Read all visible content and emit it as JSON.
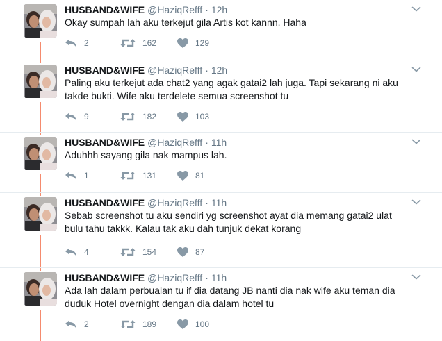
{
  "colors": {
    "thread_line": "#f58b6e",
    "name": "#14171a",
    "secondary": "#657786",
    "divider": "#e6ecf0"
  },
  "icons": {
    "avatar": "couple-profile-photo",
    "reply": "reply-icon",
    "retweet": "retweet-icon",
    "like": "heart-icon",
    "more": "chevron-down-icon"
  },
  "tweets": [
    {
      "name": "HUSBAND&WIFE",
      "handle": "@HaziqRefff",
      "separator": "·",
      "time": "12h",
      "text": "Okay sumpah lah aku terkejut gila Artis kot kannn. Haha",
      "replies": "2",
      "retweets": "162",
      "likes": "129"
    },
    {
      "name": "HUSBAND&WIFE",
      "handle": "@HaziqRefff",
      "separator": "·",
      "time": "12h",
      "text": "Paling aku terkejut ada chat2 yang agak gatai2 lah juga. Tapi sekarang ni aku\ntakde bukti. Wife aku terdelete semua screenshot tu",
      "replies": "9",
      "retweets": "182",
      "likes": "103"
    },
    {
      "name": "HUSBAND&WIFE",
      "handle": "@HaziqRefff",
      "separator": "·",
      "time": "11h",
      "text": "Aduhhh sayang gila nak mampus lah.",
      "replies": "1",
      "retweets": "131",
      "likes": "81"
    },
    {
      "name": "HUSBAND&WIFE",
      "handle": "@HaziqRefff",
      "separator": "·",
      "time": "11h",
      "text": "Sebab screenshot tu aku sendiri yg screenshot ayat dia memang gatai2 ulat\nbulu tahu takkk. Kalau tak aku dah tunjuk dekat korang",
      "replies": "4",
      "retweets": "154",
      "likes": "87"
    },
    {
      "name": "HUSBAND&WIFE",
      "handle": "@HaziqRefff",
      "separator": "·",
      "time": "11h",
      "text": "Ada lah dalam perbualan tu if dia datang JB nanti dia nak wife aku teman dia\nduduk Hotel overnight dengan dia dalam hotel tu",
      "replies": "2",
      "retweets": "189",
      "likes": "100"
    }
  ]
}
